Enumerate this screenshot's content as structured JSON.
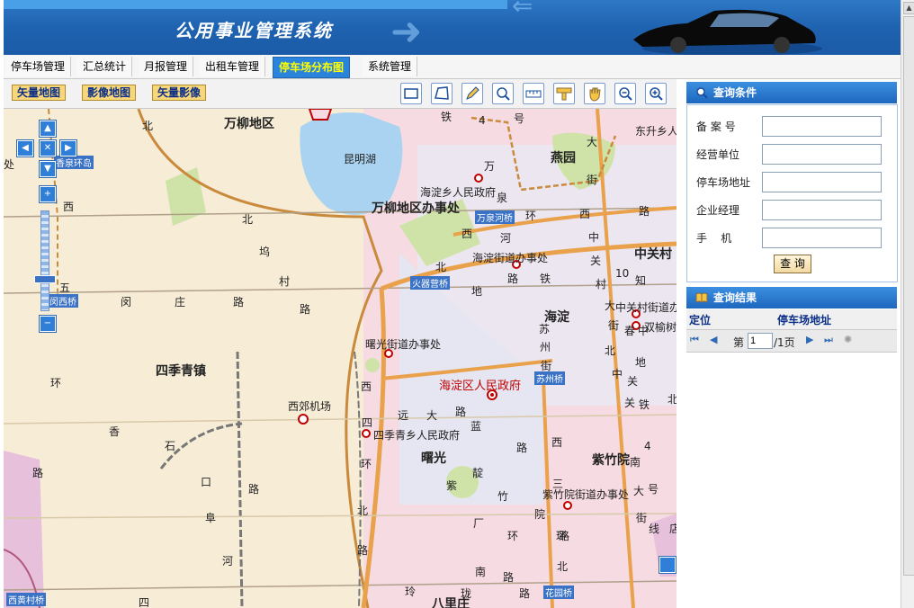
{
  "header": {
    "title": "公用事业管理系统"
  },
  "tabs": [
    {
      "label": "停车场管理"
    },
    {
      "label": "汇总统计"
    },
    {
      "label": "月报管理"
    },
    {
      "label": "出租车管理"
    },
    {
      "label": "停车场分布图",
      "active": true
    },
    {
      "label": "系统管理"
    }
  ],
  "map_layers": {
    "vector": "矢量地图",
    "image": "影像地图",
    "vector_image": "矢量影像"
  },
  "tools": [
    "rect-select-icon",
    "polygon-select-icon",
    "pencil-icon",
    "zoom-region-icon",
    "measure-icon",
    "ruler-icon",
    "pan-hand-icon",
    "zoom-out-icon",
    "zoom-in-icon"
  ],
  "map_labels": {
    "wanliu": "万柳地区",
    "kunminghu": "昆明湖",
    "yanyuan": "燕园",
    "haidianxiang": "海淀乡人民政府",
    "wanliu_office": "万柳地区办事处",
    "wanquanhe": "万泉河桥",
    "haidian_jd": "海淀街道办事处",
    "zhongguancun": "中关村",
    "huoqiying": "火器营桥",
    "haidian": "海淀",
    "zgc_jd": "中关村街道办",
    "shuangyushu": "双榆树",
    "shuguang_jd": "曙光街道办事处",
    "sijiqing": "四季青镇",
    "xijiao": "西郊机场",
    "haidian_gov": "海淀区人民政府",
    "suzhouqiao": "苏州桥",
    "sijiqing_gov": "四季青乡人民政府",
    "shuguang": "曙光",
    "zizhuyuan": "紫竹院",
    "zizhu_jd": "紫竹院街道办事处",
    "xiangquan": "香泉环岛",
    "minxi": "闵西桥",
    "xihuang": "西黄村桥",
    "huayuanqiao": "花园桥",
    "bajiazhuang": "八里庄",
    "dongsheng": "东升乡人",
    "chu": "处",
    "xi": "西",
    "w_si_1": "四",
    "w_huan_1": "环",
    "w_lu_1": "路",
    "w_bei_1": "北",
    "w_wu_1": "坞",
    "w_cun_1": "村",
    "w_lu_2": "路",
    "w_wu_2": "五",
    "w_min": "闵",
    "w_zhuang": "庄",
    "w_lu_3": "路",
    "w_xiang": "香",
    "w_shi": "石",
    "w_kou": "口",
    "w_lu_4": "路",
    "w_fu": "阜",
    "w_he": "河",
    "w_xi_2": "西",
    "w_si_2": "四",
    "w_huan_2": "环",
    "w_bei_2": "北",
    "w_lu_5": "路",
    "w_yuan": "远",
    "w_da": "大",
    "w_lu_6": "路",
    "w_lan": "蓝",
    "w_dian": "靛",
    "w_chang": "厂",
    "w_zi": "紫",
    "w_zhu": "竹",
    "w_yuan2": "院",
    "w_lu_7": "路",
    "w_huan_3": "环",
    "w_lu_8": "路",
    "w_nan": "南",
    "w_lu_9": "路",
    "w_ling": "玲",
    "w_long": "珑",
    "w_tie_1": "铁",
    "w_num_4a": "4",
    "w_hao_1": "号",
    "w_wan": "万",
    "w_quan": "泉",
    "w_he2": "河",
    "w_bei_3": "北",
    "w_lu_10": "路",
    "w_huan_4": "环",
    "w_xi_3": "西",
    "w_lu_11": "路",
    "w_xi_4": "西",
    "w_lu_12": "路",
    "w_di": "地",
    "w_tie_2": "铁",
    "w_num_10": "10",
    "w_su": "苏",
    "w_zhou": "州",
    "w_jie": "街",
    "w_da2": "大",
    "w_jie2": "街",
    "w_zhong": "中",
    "w_guan": "关",
    "w_cun2": "村",
    "w_zhi": "知",
    "w_chun": "春",
    "w_bei_4": "北",
    "w_xi_5": "西",
    "w_san": "三",
    "w_huan_5": "环",
    "w_bei_5": "北",
    "w_lu_13": "路",
    "w_zhong2": "中",
    "w_guan2": "关",
    "w_tie_3": "铁",
    "w_num_4b": "4",
    "w_di2": "地",
    "w_nan2": "南",
    "w_da3": "大",
    "w_hao_2": "号",
    "w_jie3": "街",
    "w_xian": "线",
    "w_bei_6": "北",
    "w_bei_7": "北",
    "w_da4": "大",
    "w_jie4": "街",
    "w_zhong3": "中",
    "w_guan3": "关",
    "w_dian2": "店"
  },
  "query": {
    "title": "查询条件",
    "fields": [
      {
        "label": "备 案 号",
        "value": ""
      },
      {
        "label": "经营单位",
        "value": ""
      },
      {
        "label": "停车场地址",
        "value": ""
      },
      {
        "label": "企业经理",
        "value": ""
      },
      {
        "label": "手    机",
        "value": ""
      }
    ],
    "button": "查 询"
  },
  "results": {
    "title": "查询结果",
    "columns": [
      "定位",
      "停车场地址"
    ],
    "pager": {
      "prefix": "第",
      "page": "1",
      "total": "/1页"
    }
  }
}
